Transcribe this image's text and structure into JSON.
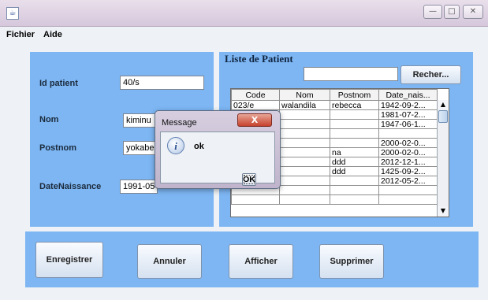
{
  "window": {
    "minimize_glyph": "—",
    "maximize_glyph": "□",
    "close_glyph": "✕",
    "app_icon_glyph": "☕"
  },
  "menu": [
    {
      "label": "Fichier"
    },
    {
      "label": "Aide"
    }
  ],
  "form": {
    "id_label": "Id patient",
    "id_value": "40/s",
    "nom_label": "Nom",
    "nom_value": "kiminu",
    "postnom_label": "Postnom",
    "postnom_value": "yokabel",
    "date_label": "DateNaissance",
    "date_value": "1991-05-"
  },
  "list": {
    "title": "Liste de Patient",
    "search_value": "",
    "search_button": "Recher...",
    "columns": [
      "Code",
      "Nom",
      "Postnom",
      "Date_nais..."
    ],
    "rows": [
      [
        "023/e",
        "walandila",
        "rebecca",
        "1942-09-2..."
      ],
      [
        "",
        "",
        "",
        "1981-07-2..."
      ],
      [
        "",
        "",
        "",
        "1947-06-1..."
      ],
      [
        "",
        "",
        "",
        ""
      ],
      [
        "",
        "",
        "",
        "2000-02-0..."
      ],
      [
        "",
        "",
        "na",
        "2000-02-0..."
      ],
      [
        "",
        "",
        "ddd",
        "2012-12-1..."
      ],
      [
        "",
        "",
        "ddd",
        "1425-09-2..."
      ],
      [
        "",
        "",
        "",
        "2012-05-2..."
      ],
      [
        "",
        "",
        "",
        ""
      ],
      [
        "",
        "",
        "",
        ""
      ]
    ]
  },
  "buttons": {
    "save": "Enregistrer",
    "cancel": "Annuler",
    "show": "Afficher",
    "delete": "Supprimer"
  },
  "dialog": {
    "title": "Message",
    "message": "ok",
    "ok_label": "OK",
    "close_glyph": "X",
    "icon_glyph": "i"
  },
  "colors": {
    "panel": "#7db6f3",
    "background": "#eef1f5"
  }
}
